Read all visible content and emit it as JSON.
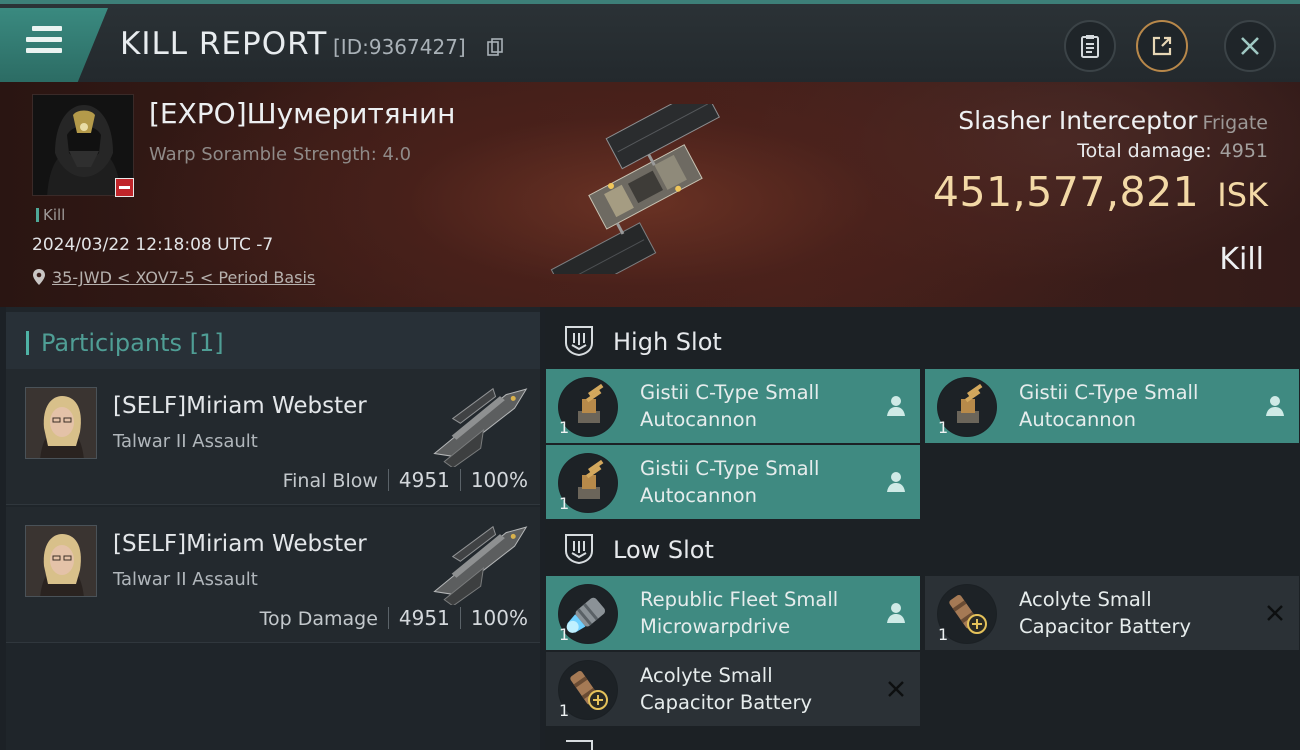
{
  "header": {
    "title": "KILL REPORT",
    "report_id": "[ID:9367427]"
  },
  "victim": {
    "name": "[EXPO]Шумеритянин",
    "subtitle": "Warp Soramble Strength: 4.0",
    "tag": "Kill",
    "timestamp": "2024/03/22 12:18:08 UTC -7",
    "location": "35-JWD < XOV7-5 < Period Basis",
    "ship_name": "Slasher Interceptor",
    "ship_class": "Frigate",
    "total_damage_label": "Total damage:",
    "total_damage": "4951",
    "isk_value": "451,577,821",
    "isk_unit": "ISK",
    "result": "Kill"
  },
  "participants": {
    "title": "Participants [1]",
    "rows": [
      {
        "name": "[SELF]Miriam Webster",
        "ship": "Talwar II Assault",
        "label": "Final Blow",
        "damage": "4951",
        "percent": "100%"
      },
      {
        "name": "[SELF]Miriam Webster",
        "ship": "Talwar II Assault",
        "label": "Top Damage",
        "damage": "4951",
        "percent": "100%"
      }
    ]
  },
  "slots": {
    "high": {
      "label": "High Slot",
      "modules": [
        {
          "name": "Gistii C-Type Small Autocannon",
          "qty": "1",
          "status": "fitted"
        },
        {
          "name": "Gistii C-Type Small Autocannon",
          "qty": "1",
          "status": "fitted"
        },
        {
          "name": "Gistii C-Type Small Autocannon",
          "qty": "1",
          "status": "fitted"
        }
      ]
    },
    "low": {
      "label": "Low Slot",
      "modules": [
        {
          "name": "Republic Fleet Small Microwarpdrive",
          "qty": "1",
          "status": "fitted"
        },
        {
          "name": "Acolyte Small Capacitor Battery",
          "qty": "1",
          "status": "destroyed"
        },
        {
          "name": "Acolyte Small Capacitor Battery",
          "qty": "1",
          "status": "destroyed"
        }
      ]
    }
  },
  "colors": {
    "accent": "#3f8a81",
    "isk": "#f3d9a6",
    "header_accent": "#3d7f78"
  },
  "icons": [
    "menu-icon",
    "copy-icon",
    "clipboard-icon",
    "share-icon",
    "close-icon",
    "location-pin-icon",
    "slot-high-icon",
    "slot-low-icon",
    "pilot-icon",
    "destroyed-x-icon"
  ]
}
